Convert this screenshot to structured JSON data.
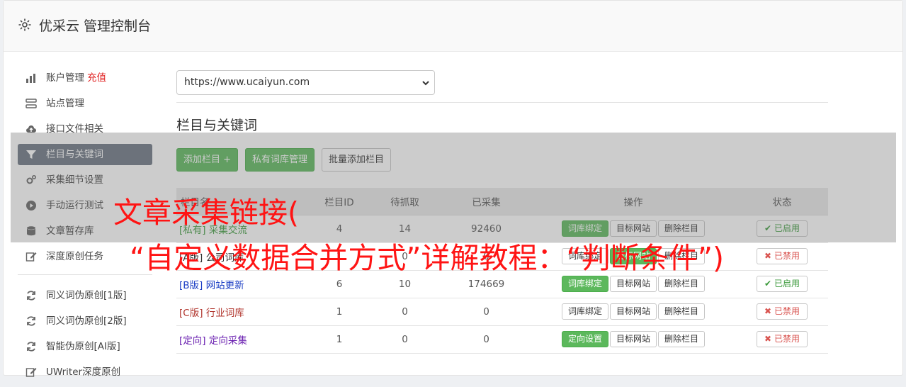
{
  "header": {
    "title": "优采云 管理控制台"
  },
  "sidebar": {
    "items": [
      {
        "label": "账户管理",
        "badge": "充值",
        "icon": "bar-chart-icon"
      },
      {
        "label": "站点管理",
        "icon": "server-icon"
      },
      {
        "label": "接口文件相关",
        "icon": "cloud-upload-icon"
      },
      {
        "label": "栏目与关键词",
        "icon": "filter-icon",
        "active": true
      },
      {
        "label": "采集细节设置",
        "icon": "cogs-icon"
      },
      {
        "label": "手动运行测试",
        "icon": "play-circle-icon"
      },
      {
        "label": "文章暂存库",
        "icon": "database-icon"
      },
      {
        "label": "深度原创任务",
        "icon": "edit-icon"
      }
    ],
    "items2": [
      {
        "label": "同义词伪原创[1版]",
        "icon": "refresh-icon"
      },
      {
        "label": "同义词伪原创[2版]",
        "icon": "refresh-icon"
      },
      {
        "label": "智能伪原创[AI版]",
        "icon": "refresh-icon"
      },
      {
        "label": "UWriter深度原创",
        "icon": "edit-icon"
      }
    ]
  },
  "main": {
    "site_select": {
      "value": "https://www.ucaiyun.com"
    },
    "section_title": "栏目与关键词",
    "buttons": {
      "add": "添加栏目 +",
      "private": "私有词库管理",
      "batch": "批量添加栏目"
    },
    "table": {
      "headers": {
        "name": "栏目名",
        "id": "栏目ID",
        "pending": "待抓取",
        "collected": "已采集",
        "ops": "操作",
        "status": "状态"
      },
      "rows": [
        {
          "tag": "[私有]",
          "name": "采集交流",
          "tag_color": "#3c9a3c",
          "id": "4",
          "pending": "14",
          "collected": "92460",
          "op1": "词库绑定",
          "op1_green": true,
          "op2": "目标网站",
          "op3": "删除栏目",
          "status": "已启用",
          "on": true
        },
        {
          "tag": "[A版]",
          "name": "公司词库",
          "tag_color": "#333333",
          "id": "1",
          "pending": "0",
          "collected": "0",
          "op1": "词库绑定",
          "op1_green": false,
          "op2": "目标网站",
          "op2_green": true,
          "op3": "删除栏目",
          "status": "已禁用",
          "on": false
        },
        {
          "tag": "[B版]",
          "name": "网站更新",
          "tag_color": "#1a3dc4",
          "id": "6",
          "pending": "10",
          "collected": "174669",
          "op1": "词库绑定",
          "op1_green": true,
          "op2": "目标网站",
          "op3": "删除栏目",
          "status": "已启用",
          "on": true
        },
        {
          "tag": "[C版]",
          "name": "行业词库",
          "tag_color": "#b0332b",
          "id": "1",
          "pending": "0",
          "collected": "0",
          "op1": "词库绑定",
          "op1_green": false,
          "op2": "目标网站",
          "op3": "删除栏目",
          "status": "已禁用",
          "on": false
        },
        {
          "tag": "[定向]",
          "name": "定向采集",
          "tag_color": "#6a1fb0",
          "id": "1",
          "pending": "0",
          "collected": "0",
          "op1": "定向设置",
          "op1_green": true,
          "op2": "目标网站",
          "op3": "删除栏目",
          "status": "已禁用",
          "on": false
        }
      ]
    }
  },
  "overlay": {
    "line1": "文章采集链接(",
    "line2": "“自定义数据合并方式”详解教程：“判断条件”)"
  }
}
